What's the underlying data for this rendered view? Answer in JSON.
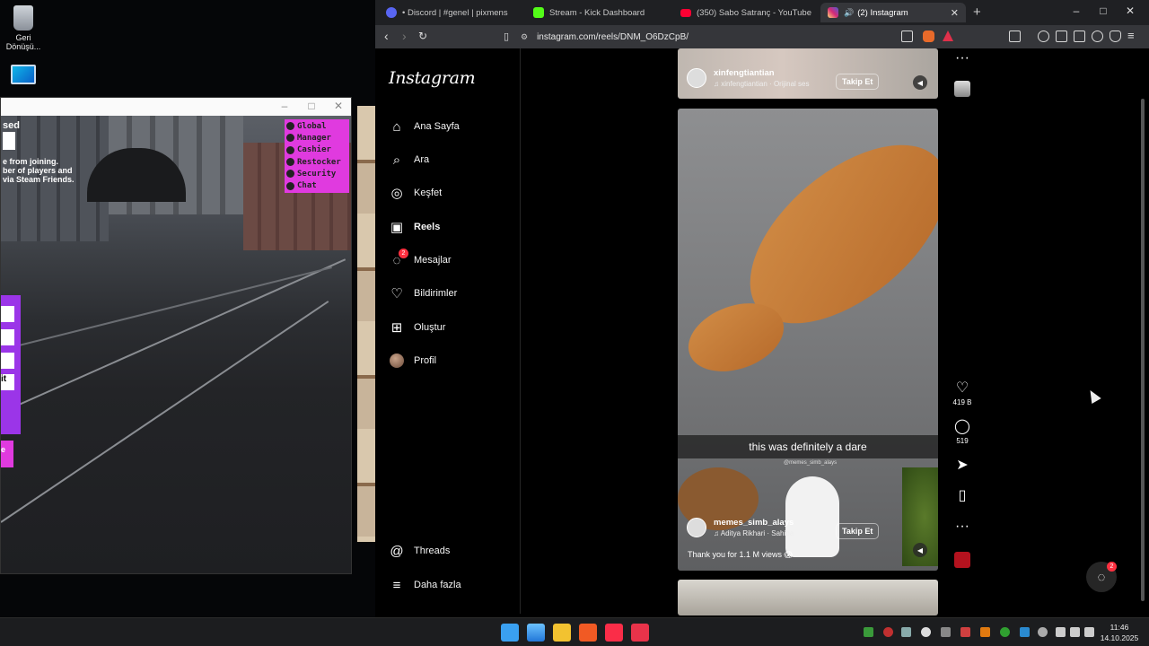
{
  "desktop": {
    "recycle_label_1": "Geri",
    "recycle_label_2": "Dönüşü..."
  },
  "game": {
    "server_title": "sed",
    "server_line_1": "e from joining.",
    "server_line_2": "ber of players and",
    "server_line_3": "via Steam Friends.",
    "roles": [
      "Global",
      "Manager",
      "Cashier",
      "Restocker",
      "Security",
      "Chat"
    ],
    "panel_fields": [
      "",
      "",
      "",
      "it"
    ],
    "pink_button_label": "e"
  },
  "browser": {
    "tabs": [
      {
        "title": "• Discord | #genel | pixmens",
        "color": "#5865f2"
      },
      {
        "title": "Stream - Kick Dashboard",
        "color": "#53fc18"
      },
      {
        "title": "(350) Sabo Satranç - YouTube",
        "color": "#ff0033"
      },
      {
        "title": "(2) Instagram",
        "color": "#e1306c"
      }
    ],
    "url": "instagram.com/reels/DNM_O6DzCpB/"
  },
  "instagram": {
    "logo": "Instagram",
    "nav": [
      {
        "label": "Ana Sayfa",
        "icon": "home-icon"
      },
      {
        "label": "Ara",
        "icon": "search-icon"
      },
      {
        "label": "Keşfet",
        "icon": "explore-icon"
      },
      {
        "label": "Reels",
        "icon": "reels-icon"
      },
      {
        "label": "Mesajlar",
        "icon": "messenger-icon",
        "badge": "2"
      },
      {
        "label": "Bildirimler",
        "icon": "heart-icon"
      },
      {
        "label": "Oluştur",
        "icon": "create-icon"
      },
      {
        "label": "Profil",
        "icon": "avatar"
      }
    ],
    "nav_bottom": [
      {
        "label": "Threads",
        "icon": "threads-icon"
      },
      {
        "label": "Daha fazla",
        "icon": "menu-icon"
      }
    ],
    "reel_top": {
      "username": "xinfengtiantian",
      "music": "xinfengtiantian · Orijinal ses",
      "follow": "Takip Et"
    },
    "reel_main": {
      "subtitle": "this was definitely a dare",
      "watermark": "@memes_simb_alays",
      "username": "memes_simb_alays",
      "music": "Aditya Rikhari · Sahiba",
      "follow": "Takip Et",
      "caption": "Thank you for 1.1 M views 😱",
      "likes": "419 B",
      "comments": "519"
    },
    "float_badge": "2"
  },
  "taskbar": {
    "time": "11:46",
    "date": "14.10.2025"
  }
}
